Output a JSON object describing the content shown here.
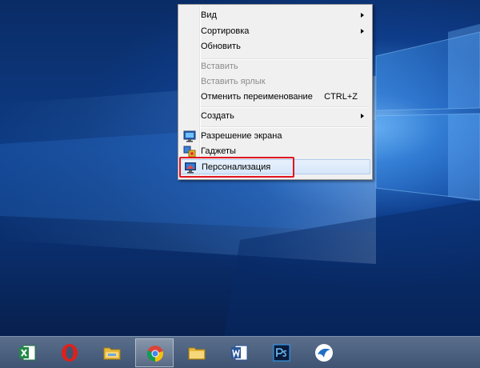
{
  "context_menu": {
    "items": [
      {
        "label": "Вид",
        "has_submenu": true
      },
      {
        "label": "Сортировка",
        "has_submenu": true
      },
      {
        "label": "Обновить"
      },
      {
        "label": "Вставить",
        "disabled": true
      },
      {
        "label": "Вставить ярлык",
        "disabled": true
      },
      {
        "label": "Отменить переименование",
        "shortcut": "CTRL+Z"
      },
      {
        "label": "Создать",
        "has_submenu": true
      },
      {
        "label": "Разрешение экрана",
        "icon": "monitor-icon"
      },
      {
        "label": "Гаджеты",
        "icon": "gadgets-icon"
      },
      {
        "label": "Персонализация",
        "icon": "personalization-icon",
        "selected": true
      }
    ]
  },
  "annotation": {
    "highlight_color": "#e0141e",
    "target": "Персонализация"
  },
  "taskbar": {
    "apps": [
      {
        "name": "excel-icon",
        "active": false
      },
      {
        "name": "opera-icon",
        "active": false
      },
      {
        "name": "file-explorer-icon",
        "active": false
      },
      {
        "name": "chrome-icon",
        "active": true
      },
      {
        "name": "folder-icon",
        "active": false
      },
      {
        "name": "word-icon",
        "active": false
      },
      {
        "name": "photoshop-icon",
        "active": false
      },
      {
        "name": "app-bird-icon",
        "active": false
      }
    ]
  },
  "colors": {
    "desktop_bg": "#0b2f6b",
    "menu_bg": "#f0f0f0",
    "selected_bg": "#d6e6f8",
    "taskbar_bg": "#4a5f7e"
  }
}
